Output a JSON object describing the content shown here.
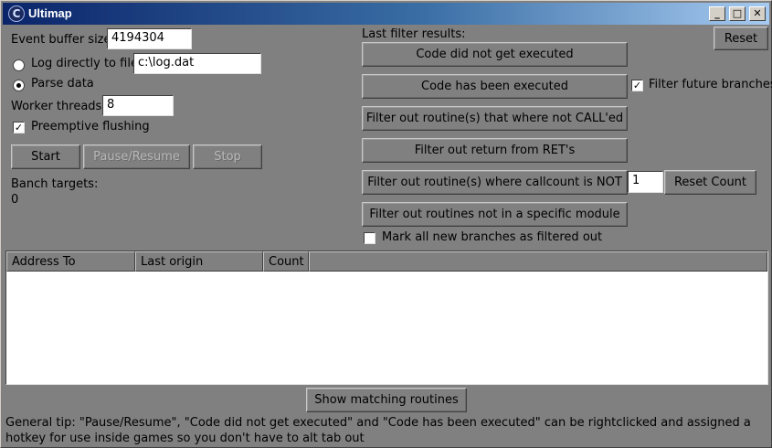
{
  "window": {
    "title": "Ultimap",
    "minimize": "_",
    "maximize": "□",
    "close": "✕"
  },
  "left": {
    "event_buffer_label": "Event buffer size",
    "event_buffer_value": "4194304",
    "log_radio_label": "Log directly to file",
    "log_radio_checked": false,
    "log_file_value": "c:\\log.dat",
    "parse_radio_label": "Parse data",
    "parse_radio_checked": true,
    "worker_threads_label": "Worker threads",
    "worker_threads_value": "8",
    "preemptive_label": "Preemptive flushing",
    "preemptive_checked": true,
    "start_label": "Start",
    "pause_label": "Pause/Resume",
    "stop_label": "Stop",
    "branch_targets_label": "Banch targets:",
    "branch_targets_value": "0"
  },
  "filters": {
    "last_results_label": "Last filter results:",
    "reset_label": "Reset",
    "not_executed_label": "Code did not get executed",
    "executed_label": "Code has been executed",
    "filter_future_label": "Filter future branches",
    "filter_future_checked": true,
    "not_called_label": "Filter out routine(s) that where not CALL'ed",
    "ret_label": "Filter out return from RET's",
    "callcount_label": "Filter out routine(s) where callcount is NOT",
    "callcount_value": "1",
    "reset_count_label": "Reset Count",
    "module_label": "Filter out routines not in a specific module",
    "mark_filtered_label": "Mark all new branches as filtered out",
    "mark_filtered_checked": false
  },
  "table": {
    "columns": [
      "Address To",
      "Last origin",
      "Count"
    ]
  },
  "bottom": {
    "show_matching_label": "Show matching routines",
    "tip": "General tip: \"Pause/Resume\", \"Code did not get executed\" and \"Code has been executed\" can be rightclicked and assigned a hotkey for use inside games so you don't have to alt tab out"
  }
}
